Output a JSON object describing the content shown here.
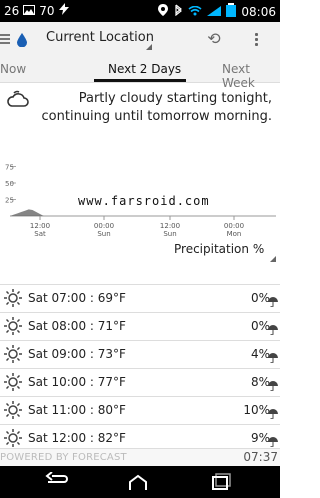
{
  "status_bar": {
    "left_items": [
      "26",
      "70"
    ],
    "time": "08:06"
  },
  "app_bar": {
    "location": "Current Location"
  },
  "tabs": [
    {
      "label": "Now"
    },
    {
      "label": "Next 2 Days"
    },
    {
      "label": "Next Week"
    }
  ],
  "summary": {
    "text": "Partly cloudy starting tonight, continuing until tomorrow morning."
  },
  "chart_data": {
    "type": "area",
    "y_ticks": [
      "75",
      "50",
      "25"
    ],
    "x_ticks": [
      {
        "time": "12:00",
        "day": "Sat"
      },
      {
        "time": "00:00",
        "day": "Sun"
      },
      {
        "time": "12:00",
        "day": "Sun"
      },
      {
        "time": "00:00",
        "day": "Mon"
      }
    ],
    "series": [
      {
        "values": [
          0,
          2,
          4,
          6,
          8,
          10,
          9,
          6,
          3,
          0,
          0,
          0,
          0,
          0,
          0,
          0,
          0,
          0,
          0,
          0,
          0,
          0,
          0,
          0,
          0,
          0,
          0,
          0,
          0,
          0,
          0,
          0,
          0,
          0,
          0,
          0,
          0,
          0,
          0,
          0,
          0,
          0,
          0,
          0,
          0,
          0,
          0,
          0,
          0,
          0,
          0,
          0,
          0,
          0,
          0,
          0,
          0,
          0,
          0,
          0,
          0,
          0,
          0,
          0,
          0,
          0,
          0,
          0,
          0,
          0,
          0,
          0
        ]
      }
    ],
    "ylim": [
      0,
      100
    ],
    "watermark": "www.farsroid.com"
  },
  "metric_selector": {
    "label": "Precipitation %"
  },
  "hourly_rows": [
    {
      "text": "Sat 07:00 : 69°F",
      "pct": "0%"
    },
    {
      "text": "Sat 08:00 : 71°F",
      "pct": "0%"
    },
    {
      "text": "Sat 09:00 : 73°F",
      "pct": "4%"
    },
    {
      "text": "Sat 10:00 : 77°F",
      "pct": "8%"
    },
    {
      "text": "Sat 11:00 : 80°F",
      "pct": "10%"
    },
    {
      "text": "Sat 12:00 : 82°F",
      "pct": "9%"
    }
  ],
  "footer": {
    "left": "POWERED BY FORECAST",
    "right": "07:37"
  }
}
